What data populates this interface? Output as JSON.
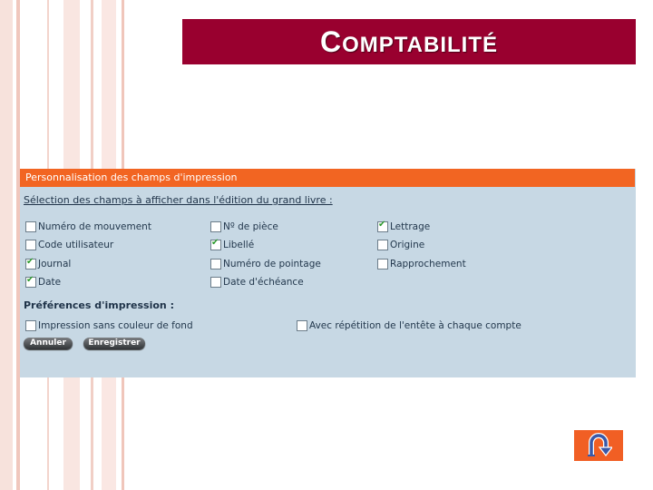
{
  "slide": {
    "title_first_letter": "C",
    "title_rest": "OMPTABILITÉ"
  },
  "panel": {
    "header": "Personnalisation des champs d'impression",
    "fields_section_title": "Sélection des champs à afficher dans l'édition du grand livre :",
    "print_section_title": "Préférences d'impression :",
    "fields": [
      {
        "label": "Numéro de mouvement",
        "checked": false
      },
      {
        "label": "Nº de pièce",
        "checked": false
      },
      {
        "label": "Lettrage",
        "checked": true
      },
      {
        "label": "Code utilisateur",
        "checked": false
      },
      {
        "label": "Libellé",
        "checked": true
      },
      {
        "label": "Origine",
        "checked": false
      },
      {
        "label": "Journal",
        "checked": true
      },
      {
        "label": "Numéro de pointage",
        "checked": false
      },
      {
        "label": "Rapprochement",
        "checked": false
      },
      {
        "label": "Date",
        "checked": true
      },
      {
        "label": "Date d'échéance",
        "checked": false
      }
    ],
    "print_options": [
      {
        "label": "Impression sans couleur de fond",
        "checked": false
      },
      {
        "label": "Avec répétition de l'entête à chaque compte",
        "checked": false
      }
    ],
    "cancel_label": "Annuler",
    "save_label": "Enregistrer"
  },
  "colors": {
    "title_bar": "#99002f",
    "panel_header": "#f26522",
    "panel_bg": "#c7d8e4",
    "return_button": "#f15f24"
  },
  "icons": {
    "return": "u-turn-arrow-icon"
  }
}
